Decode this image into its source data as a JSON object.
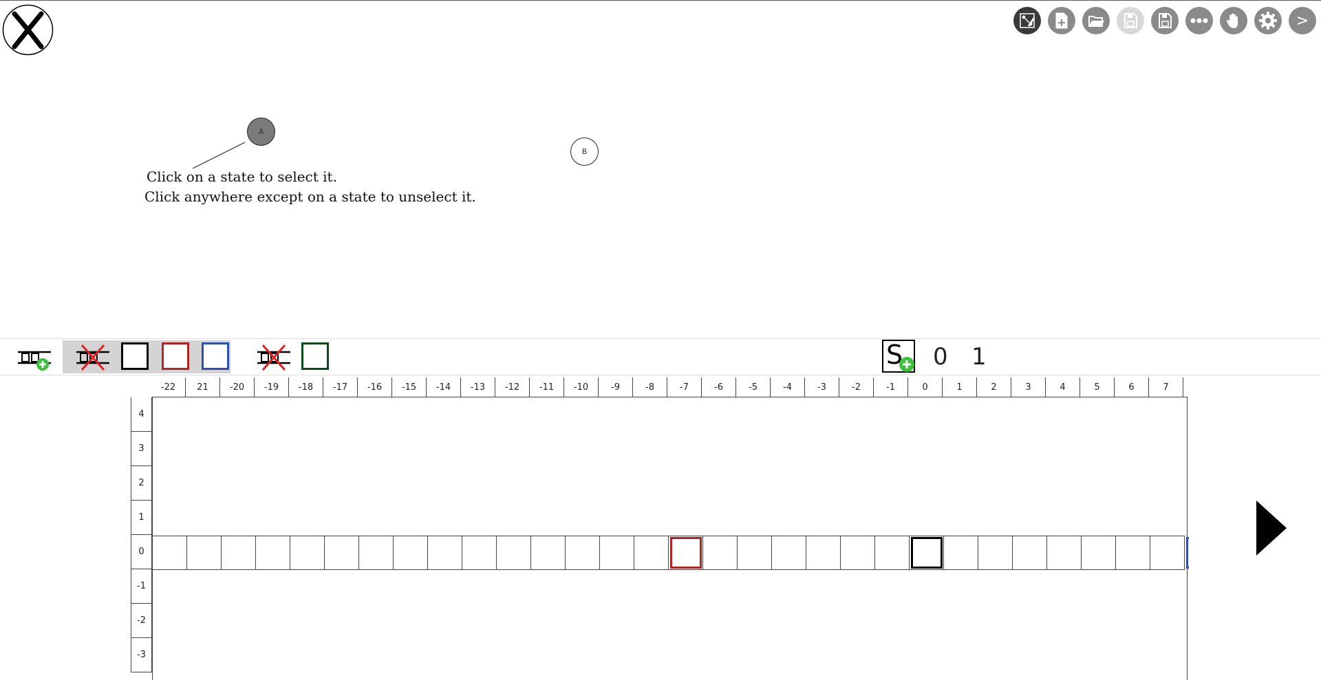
{
  "header": {
    "close_icon": "close-x-icon",
    "toolbar_buttons": [
      {
        "name": "edit-mode-button",
        "icon": "pencil-diagram-icon"
      },
      {
        "name": "new-file-button",
        "icon": "new-file-icon"
      },
      {
        "name": "open-file-button",
        "icon": "open-folder-icon"
      },
      {
        "name": "save-button",
        "icon": "floppy-icon"
      },
      {
        "name": "save-as-button",
        "icon": "floppy-icon"
      },
      {
        "name": "more-button",
        "icon": "ellipsis-icon"
      },
      {
        "name": "pan-button",
        "icon": "hand-icon"
      },
      {
        "name": "settings-button",
        "icon": "gear-icon"
      },
      {
        "name": "next-button",
        "icon": "greater-than-icon",
        "label": ">"
      }
    ]
  },
  "canvas": {
    "states": [
      {
        "label": "A",
        "selected": true
      },
      {
        "label": "B",
        "selected": false
      }
    ],
    "hint_lines": [
      "Click on a state to select it.",
      "Click anywhere except on a state to unselect it."
    ]
  },
  "tape_toolbar": {
    "tools": [
      "add-tape-icon",
      "delete-tape-icon",
      "delete-tape-icon"
    ],
    "colors": {
      "black": "#000000",
      "red": "#b22222",
      "blue": "#2d4fb5",
      "green": "#0d4a1a"
    },
    "start_symbol": "S",
    "alphabet": [
      "0",
      "1"
    ]
  },
  "tape": {
    "columns": [
      "-22",
      "21",
      "-20",
      "-19",
      "-18",
      "-17",
      "-16",
      "-15",
      "-14",
      "-13",
      "-12",
      "-11",
      "-10",
      "-9",
      "-8",
      "-7",
      "-6",
      "-5",
      "-4",
      "-3",
      "-2",
      "-1",
      "0",
      "1",
      "2",
      "3",
      "4",
      "5",
      "6",
      "7"
    ],
    "rows": [
      "4",
      "3",
      "2",
      "1",
      "0",
      "-1",
      "-2",
      "-3"
    ],
    "red_head_column": "-7",
    "black_head_column": "0"
  },
  "side_play_icon": "play-triangle-icon"
}
